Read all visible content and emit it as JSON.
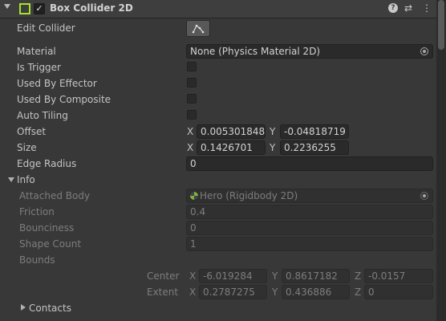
{
  "header": {
    "title": "Box Collider 2D",
    "enabled_mark": "✓",
    "help_icon": "?",
    "preset_icon": "⇄",
    "menu_icon": "⋮"
  },
  "rows": {
    "edit_collider": "Edit Collider",
    "material": {
      "label": "Material",
      "value": "None (Physics Material 2D)"
    },
    "is_trigger": "Is Trigger",
    "used_by_effector": "Used By Effector",
    "used_by_composite": "Used By Composite",
    "auto_tiling": "Auto Tiling",
    "offset": {
      "label": "Offset",
      "x_label": "X",
      "x": "0.005301848",
      "y_label": "Y",
      "y": "-0.04818719"
    },
    "size": {
      "label": "Size",
      "x_label": "X",
      "x": "0.1426701",
      "y_label": "Y",
      "y": "0.2236255"
    },
    "edge_radius": {
      "label": "Edge Radius",
      "value": "0"
    }
  },
  "info": {
    "label": "Info",
    "attached_body": {
      "label": "Attached Body",
      "value": "Hero (Rigidbody 2D)"
    },
    "friction": {
      "label": "Friction",
      "value": "0.4"
    },
    "bounciness": {
      "label": "Bounciness",
      "value": "0"
    },
    "shape_count": {
      "label": "Shape Count",
      "value": "1"
    },
    "bounds": {
      "label": "Bounds",
      "center": {
        "label": "Center",
        "x_label": "X",
        "x": "-6.019284",
        "y_label": "Y",
        "y": "0.8617182",
        "z_label": "Z",
        "z": "-0.0157"
      },
      "extent": {
        "label": "Extent",
        "x_label": "X",
        "x": "0.2787275",
        "y_label": "Y",
        "y": "0.436886",
        "z_label": "Z",
        "z": "0"
      }
    },
    "contacts": "Contacts"
  }
}
